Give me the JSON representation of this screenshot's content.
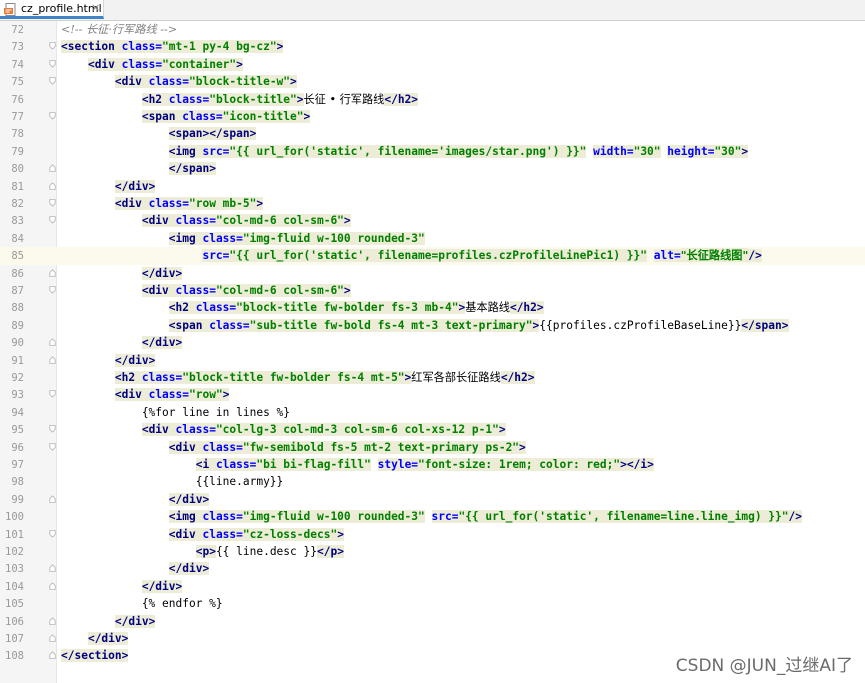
{
  "editor": {
    "tab": {
      "filename": "cz_profile.html",
      "close_glyph": "×",
      "icon": "html-file-icon"
    },
    "current_line": 85,
    "lines": [
      {
        "n": "72",
        "fold": "",
        "tokens": [
          {
            "t": "c",
            "v": "<!-- 长征·行军路线 -->"
          }
        ]
      },
      {
        "n": "73",
        "fold": "open",
        "tokens": [
          {
            "t": "t",
            "v": "<section "
          },
          {
            "t": "a",
            "v": "class="
          },
          {
            "t": "s",
            "v": "\"mt-1 py-4 bg-cz\""
          },
          {
            "t": "t",
            "v": ">"
          }
        ]
      },
      {
        "n": "74",
        "fold": "open",
        "tokens": [
          {
            "t": "p",
            "v": "    "
          },
          {
            "t": "t",
            "v": "<div "
          },
          {
            "t": "a",
            "v": "class="
          },
          {
            "t": "s",
            "v": "\"container\""
          },
          {
            "t": "t",
            "v": ">"
          }
        ]
      },
      {
        "n": "75",
        "fold": "open",
        "tokens": [
          {
            "t": "p",
            "v": "        "
          },
          {
            "t": "t",
            "v": "<div "
          },
          {
            "t": "a",
            "v": "class="
          },
          {
            "t": "s",
            "v": "\"block-title-w\""
          },
          {
            "t": "t",
            "v": ">"
          }
        ]
      },
      {
        "n": "76",
        "fold": "",
        "tokens": [
          {
            "t": "p",
            "v": "            "
          },
          {
            "t": "t",
            "v": "<h2 "
          },
          {
            "t": "a",
            "v": "class="
          },
          {
            "t": "s",
            "v": "\"block-title\""
          },
          {
            "t": "t",
            "v": ">"
          },
          {
            "t": "p",
            "v": "长征 • 行军路线"
          },
          {
            "t": "t",
            "v": "</h2>"
          }
        ]
      },
      {
        "n": "77",
        "fold": "open",
        "tokens": [
          {
            "t": "p",
            "v": "            "
          },
          {
            "t": "t",
            "v": "<span "
          },
          {
            "t": "a",
            "v": "class="
          },
          {
            "t": "s",
            "v": "\"icon-title\""
          },
          {
            "t": "t",
            "v": ">"
          }
        ]
      },
      {
        "n": "78",
        "fold": "",
        "tokens": [
          {
            "t": "p",
            "v": "                "
          },
          {
            "t": "t",
            "v": "<span></span>"
          }
        ]
      },
      {
        "n": "79",
        "fold": "",
        "tokens": [
          {
            "t": "p",
            "v": "                "
          },
          {
            "t": "t",
            "v": "<img "
          },
          {
            "t": "a",
            "v": "src="
          },
          {
            "t": "s",
            "v": "\"{{ url_for('static', filename='images/star.png') }}\""
          },
          {
            "t": "p",
            "v": " "
          },
          {
            "t": "a",
            "v": "width="
          },
          {
            "t": "s",
            "v": "\"30\""
          },
          {
            "t": "p",
            "v": " "
          },
          {
            "t": "a",
            "v": "height="
          },
          {
            "t": "s",
            "v": "\"30\""
          },
          {
            "t": "t",
            "v": ">"
          }
        ]
      },
      {
        "n": "80",
        "fold": "close",
        "tokens": [
          {
            "t": "p",
            "v": "                "
          },
          {
            "t": "t",
            "v": "</span>"
          }
        ]
      },
      {
        "n": "81",
        "fold": "close",
        "tokens": [
          {
            "t": "p",
            "v": "        "
          },
          {
            "t": "t",
            "v": "</div>"
          }
        ]
      },
      {
        "n": "82",
        "fold": "open",
        "tokens": [
          {
            "t": "p",
            "v": "        "
          },
          {
            "t": "t",
            "v": "<div "
          },
          {
            "t": "a",
            "v": "class="
          },
          {
            "t": "s",
            "v": "\"row mb-5\""
          },
          {
            "t": "t",
            "v": ">"
          }
        ]
      },
      {
        "n": "83",
        "fold": "open",
        "tokens": [
          {
            "t": "p",
            "v": "            "
          },
          {
            "t": "t",
            "v": "<div "
          },
          {
            "t": "a",
            "v": "class="
          },
          {
            "t": "s",
            "v": "\"col-md-6 col-sm-6\""
          },
          {
            "t": "t",
            "v": ">"
          }
        ]
      },
      {
        "n": "84",
        "fold": "",
        "tokens": [
          {
            "t": "p",
            "v": "                "
          },
          {
            "t": "t",
            "v": "<img "
          },
          {
            "t": "a",
            "v": "class="
          },
          {
            "t": "s",
            "v": "\"img-fluid w-100 rounded-3\""
          }
        ]
      },
      {
        "n": "85",
        "fold": "",
        "tokens": [
          {
            "t": "p",
            "v": "                     "
          },
          {
            "t": "a",
            "v": "src="
          },
          {
            "t": "s",
            "v": "\"{{ url_for('static', filename=profiles.czProfileLinePic1) }}\""
          },
          {
            "t": "p",
            "v": " "
          },
          {
            "t": "a",
            "v": "alt="
          },
          {
            "t": "s",
            "v": "\"长征路线图\""
          },
          {
            "t": "t",
            "v": "/>"
          }
        ]
      },
      {
        "n": "86",
        "fold": "close",
        "tokens": [
          {
            "t": "p",
            "v": "            "
          },
          {
            "t": "t",
            "v": "</div>"
          }
        ]
      },
      {
        "n": "87",
        "fold": "open",
        "tokens": [
          {
            "t": "p",
            "v": "            "
          },
          {
            "t": "t",
            "v": "<div "
          },
          {
            "t": "a",
            "v": "class="
          },
          {
            "t": "s",
            "v": "\"col-md-6 col-sm-6\""
          },
          {
            "t": "t",
            "v": ">"
          }
        ]
      },
      {
        "n": "88",
        "fold": "",
        "tokens": [
          {
            "t": "p",
            "v": "                "
          },
          {
            "t": "t",
            "v": "<h2 "
          },
          {
            "t": "a",
            "v": "class="
          },
          {
            "t": "s",
            "v": "\"block-title fw-bolder fs-3 mb-4\""
          },
          {
            "t": "t",
            "v": ">"
          },
          {
            "t": "p",
            "v": "基本路线"
          },
          {
            "t": "t",
            "v": "</h2>"
          }
        ]
      },
      {
        "n": "89",
        "fold": "",
        "tokens": [
          {
            "t": "p",
            "v": "                "
          },
          {
            "t": "t",
            "v": "<span "
          },
          {
            "t": "a",
            "v": "class="
          },
          {
            "t": "s",
            "v": "\"sub-title fw-bold fs-4 mt-3 text-primary\""
          },
          {
            "t": "t",
            "v": ">"
          },
          {
            "t": "p",
            "v": "{{profiles.czProfileBaseLine}}"
          },
          {
            "t": "t",
            "v": "</span>"
          }
        ]
      },
      {
        "n": "90",
        "fold": "close",
        "tokens": [
          {
            "t": "p",
            "v": "            "
          },
          {
            "t": "t",
            "v": "</div>"
          }
        ]
      },
      {
        "n": "91",
        "fold": "close",
        "tokens": [
          {
            "t": "p",
            "v": "        "
          },
          {
            "t": "t",
            "v": "</div>"
          }
        ]
      },
      {
        "n": "92",
        "fold": "",
        "tokens": [
          {
            "t": "p",
            "v": "        "
          },
          {
            "t": "t",
            "v": "<h2 "
          },
          {
            "t": "a",
            "v": "class="
          },
          {
            "t": "s",
            "v": "\"block-title fw-bolder fs-4 mt-5\""
          },
          {
            "t": "t",
            "v": ">"
          },
          {
            "t": "p",
            "v": "红军各部长征路线"
          },
          {
            "t": "t",
            "v": "</h2>"
          }
        ]
      },
      {
        "n": "93",
        "fold": "open",
        "tokens": [
          {
            "t": "p",
            "v": "        "
          },
          {
            "t": "t",
            "v": "<div "
          },
          {
            "t": "a",
            "v": "class="
          },
          {
            "t": "s",
            "v": "\"row\""
          },
          {
            "t": "t",
            "v": ">"
          }
        ]
      },
      {
        "n": "94",
        "fold": "",
        "tokens": [
          {
            "t": "p",
            "v": "            {%for line in lines %}"
          }
        ]
      },
      {
        "n": "95",
        "fold": "open",
        "tokens": [
          {
            "t": "p",
            "v": "            "
          },
          {
            "t": "t",
            "v": "<div "
          },
          {
            "t": "a",
            "v": "class="
          },
          {
            "t": "s",
            "v": "\"col-lg-3 col-md-3 col-sm-6 col-xs-12 p-1\""
          },
          {
            "t": "t",
            "v": ">"
          }
        ]
      },
      {
        "n": "96",
        "fold": "open",
        "tokens": [
          {
            "t": "p",
            "v": "                "
          },
          {
            "t": "t",
            "v": "<div "
          },
          {
            "t": "a",
            "v": "class="
          },
          {
            "t": "s",
            "v": "\"fw-semibold fs-5 mt-2 text-primary ps-2\""
          },
          {
            "t": "t",
            "v": ">"
          }
        ]
      },
      {
        "n": "97",
        "fold": "",
        "tokens": [
          {
            "t": "p",
            "v": "                    "
          },
          {
            "t": "t",
            "v": "<i "
          },
          {
            "t": "a",
            "v": "class="
          },
          {
            "t": "s",
            "v": "\"bi bi-flag-fill\""
          },
          {
            "t": "p",
            "v": " "
          },
          {
            "t": "a",
            "v": "style="
          },
          {
            "t": "s",
            "v": "\"font-size: 1rem; color: red;\""
          },
          {
            "t": "t",
            "v": "></i>"
          }
        ]
      },
      {
        "n": "98",
        "fold": "",
        "tokens": [
          {
            "t": "p",
            "v": "                    {{line.army}}"
          }
        ]
      },
      {
        "n": "99",
        "fold": "close",
        "tokens": [
          {
            "t": "p",
            "v": "                "
          },
          {
            "t": "t",
            "v": "</div>"
          }
        ]
      },
      {
        "n": "100",
        "fold": "",
        "tokens": [
          {
            "t": "p",
            "v": "                "
          },
          {
            "t": "t",
            "v": "<img "
          },
          {
            "t": "a",
            "v": "class="
          },
          {
            "t": "s",
            "v": "\"img-fluid w-100 rounded-3\""
          },
          {
            "t": "p",
            "v": " "
          },
          {
            "t": "a",
            "v": "src="
          },
          {
            "t": "s",
            "v": "\"{{ url_for('static', filename=line.line_img) }}\""
          },
          {
            "t": "t",
            "v": "/>"
          }
        ]
      },
      {
        "n": "101",
        "fold": "open",
        "tokens": [
          {
            "t": "p",
            "v": "                "
          },
          {
            "t": "t",
            "v": "<div "
          },
          {
            "t": "a",
            "v": "class="
          },
          {
            "t": "s",
            "v": "\"cz-loss-decs\""
          },
          {
            "t": "t",
            "v": ">"
          }
        ]
      },
      {
        "n": "102",
        "fold": "",
        "tokens": [
          {
            "t": "p",
            "v": "                    "
          },
          {
            "t": "t",
            "v": "<p>"
          },
          {
            "t": "p",
            "v": "{{ line.desc }}"
          },
          {
            "t": "t",
            "v": "</p>"
          }
        ]
      },
      {
        "n": "103",
        "fold": "close",
        "tokens": [
          {
            "t": "p",
            "v": "                "
          },
          {
            "t": "t",
            "v": "</div>"
          }
        ]
      },
      {
        "n": "104",
        "fold": "close",
        "tokens": [
          {
            "t": "p",
            "v": "            "
          },
          {
            "t": "t",
            "v": "</div>"
          }
        ]
      },
      {
        "n": "105",
        "fold": "",
        "tokens": [
          {
            "t": "p",
            "v": "            {% endfor %}"
          }
        ]
      },
      {
        "n": "106",
        "fold": "close",
        "tokens": [
          {
            "t": "p",
            "v": "        "
          },
          {
            "t": "t",
            "v": "</div>"
          }
        ]
      },
      {
        "n": "107",
        "fold": "close",
        "tokens": [
          {
            "t": "p",
            "v": "    "
          },
          {
            "t": "t",
            "v": "</div>"
          }
        ]
      },
      {
        "n": "108",
        "fold": "close",
        "tokens": [
          {
            "t": "t",
            "v": "</section>"
          }
        ]
      }
    ]
  },
  "watermark": "CSDN @JUN_过继AI了",
  "colors": {
    "tag": "#000080",
    "attribute": "#0000ff",
    "string": "#008000",
    "comment": "#808080",
    "current_line_bg": "#fcfaed",
    "gutter_bg": "#f5f5f5",
    "tab_accent": "#4083c9"
  }
}
